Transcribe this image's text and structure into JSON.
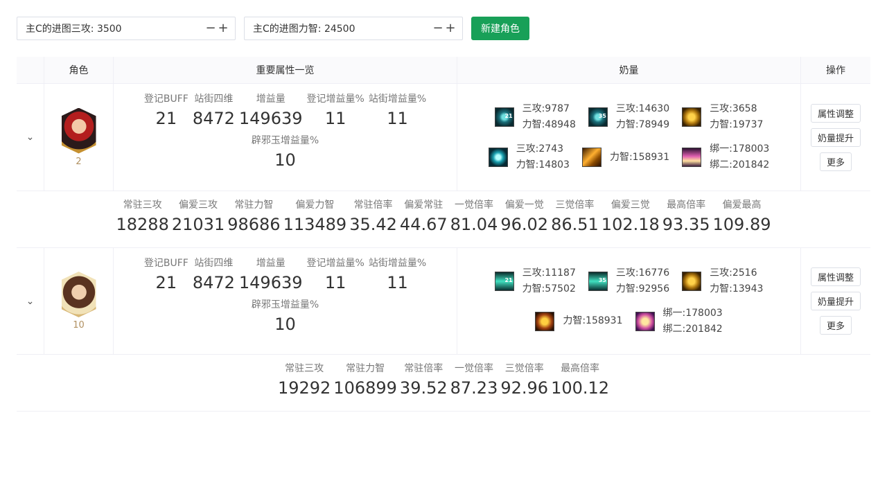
{
  "controls": {
    "input1_label": "主C的进图三攻: 3500",
    "input2_label": "主C的进图力智: 24500",
    "minus": "−",
    "plus": "+",
    "new_role_button": "新建角色"
  },
  "table": {
    "headers": {
      "role": "角色",
      "attrs": "重要属性一览",
      "milk": "奶量",
      "ops": "操作"
    },
    "expand_icon": "⌄",
    "ops": {
      "adjust": "属性调整",
      "boost": "奶量提升",
      "more": "更多"
    },
    "rows": [
      {
        "level": "2",
        "avatar": "character-avatar-red",
        "stats": [
          {
            "label": "登记BUFF",
            "value": "21"
          },
          {
            "label": "站街四维",
            "value": "8472"
          },
          {
            "label": "增益量",
            "value": "149639"
          },
          {
            "label": "登记增益量%",
            "value": "11"
          },
          {
            "label": "站街增益量%",
            "value": "11"
          }
        ],
        "stats2": [
          {
            "label": "辟邪玉增益量%",
            "value": "10"
          }
        ],
        "milk_row1": [
          {
            "icon": "teal-skill-icon",
            "badge": "21",
            "line1": "三攻:9787",
            "line2": "力智:48948"
          },
          {
            "icon": "teal-skill-icon",
            "badge": "35",
            "line1": "三攻:14630",
            "line2": "力智:78949"
          },
          {
            "icon": "golden-skill-icon",
            "badge": "",
            "line1": "三攻:3658",
            "line2": "力智:19737"
          }
        ],
        "milk_row2": [
          {
            "icon": "heart-skill-icon",
            "badge": "",
            "line1": "三攻:2743",
            "line2": "力智:14803"
          },
          {
            "icon": "orange-skill-icon",
            "badge": "",
            "line1": "力智:158931",
            "line2": ""
          },
          {
            "icon": "pink-skill-icon",
            "badge": "",
            "line1": "绑一:178003",
            "line2": "绑二:201842"
          }
        ],
        "detail": [
          {
            "label": "常驻三攻",
            "value": "18288"
          },
          {
            "label": "偏爱三攻",
            "value": "21031"
          },
          {
            "label": "常驻力智",
            "value": "98686"
          },
          {
            "label": "偏爱力智",
            "value": "113489"
          },
          {
            "label": "常驻倍率",
            "value": "35.42"
          },
          {
            "label": "偏爱常驻",
            "value": "44.67"
          },
          {
            "label": "一觉倍率",
            "value": "81.04"
          },
          {
            "label": "偏爱一觉",
            "value": "96.02"
          },
          {
            "label": "三觉倍率",
            "value": "86.51"
          },
          {
            "label": "偏爱三觉",
            "value": "102.18"
          },
          {
            "label": "最高倍率",
            "value": "93.35"
          },
          {
            "label": "偏爱最高",
            "value": "109.89"
          }
        ]
      },
      {
        "level": "10",
        "avatar": "character-avatar-gold",
        "stats": [
          {
            "label": "登记BUFF",
            "value": "21"
          },
          {
            "label": "站街四维",
            "value": "8472"
          },
          {
            "label": "增益量",
            "value": "149639"
          },
          {
            "label": "登记增益量%",
            "value": "11"
          },
          {
            "label": "站街增益量%",
            "value": "11"
          }
        ],
        "stats2": [
          {
            "label": "辟邪玉增益量%",
            "value": "10"
          }
        ],
        "milk_row1": [
          {
            "icon": "sword-skill-icon",
            "badge": "21",
            "line1": "三攻:11187",
            "line2": "力智:57502"
          },
          {
            "icon": "sword-skill-icon",
            "badge": "35",
            "line1": "三攻:16776",
            "line2": "力智:92956"
          },
          {
            "icon": "golden-skill-icon",
            "badge": "",
            "line1": "三攻:2516",
            "line2": "力智:13943"
          }
        ],
        "milk_row2": [
          {
            "icon": "cross-skill-icon",
            "badge": "",
            "line1": "力智:158931",
            "line2": ""
          },
          {
            "icon": "angel-skill-icon",
            "badge": "",
            "line1": "绑一:178003",
            "line2": "绑二:201842"
          }
        ],
        "detail": [
          {
            "label": "常驻三攻",
            "value": "19292"
          },
          {
            "label": "常驻力智",
            "value": "106899"
          },
          {
            "label": "常驻倍率",
            "value": "39.52"
          },
          {
            "label": "一觉倍率",
            "value": "87.23"
          },
          {
            "label": "三觉倍率",
            "value": "92.96"
          },
          {
            "label": "最高倍率",
            "value": "100.12"
          }
        ]
      }
    ]
  }
}
